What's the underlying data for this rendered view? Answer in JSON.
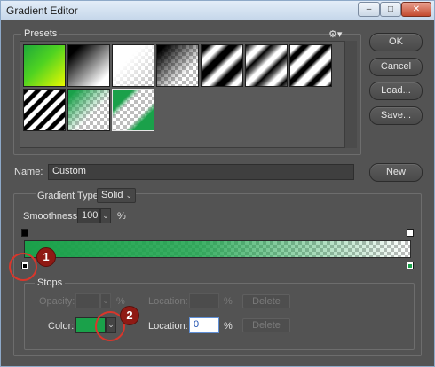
{
  "window": {
    "title": "Gradient Editor",
    "controls": {
      "minimize": "–",
      "maximize": "□",
      "close": "✕"
    }
  },
  "buttons": {
    "ok": "OK",
    "cancel": "Cancel",
    "load": "Load...",
    "save": "Save...",
    "new": "New"
  },
  "presets": {
    "legend": "Presets",
    "menu_icon": "gear-icon",
    "menu_glyph": "⚙▾",
    "items": [
      {
        "name": "green-to-yellow"
      },
      {
        "name": "black-to-white"
      },
      {
        "name": "white-to-transparent"
      },
      {
        "name": "black-to-transparent"
      },
      {
        "name": "black-white-diagonal"
      },
      {
        "name": "black-white-stripes"
      },
      {
        "name": "black-white-diagonal-2"
      },
      {
        "name": "black-white-stripes-2"
      },
      {
        "name": "green-to-transparent"
      },
      {
        "name": "green-corner-transparent"
      }
    ]
  },
  "name_field": {
    "label": "Name:",
    "value": "Custom"
  },
  "gradient": {
    "legend_group": "",
    "type_label": "Gradient Type:",
    "type_value": "Solid",
    "smoothness_label": "Smoothness:",
    "smoothness_value": "100",
    "smoothness_unit": "%",
    "bar_color": "#1aa14a"
  },
  "stops": {
    "legend": "Stops",
    "opacity_label": "Opacity:",
    "opacity_unit": "%",
    "opacity_location_label": "Location:",
    "opacity_location_unit": "%",
    "opacity_delete": "Delete",
    "color_label": "Color:",
    "color_value": "#1aa14a",
    "color_location_label": "Location:",
    "color_location_value": "0",
    "color_location_unit": "%",
    "color_delete": "Delete"
  },
  "annotations": {
    "one": "1",
    "two": "2"
  }
}
